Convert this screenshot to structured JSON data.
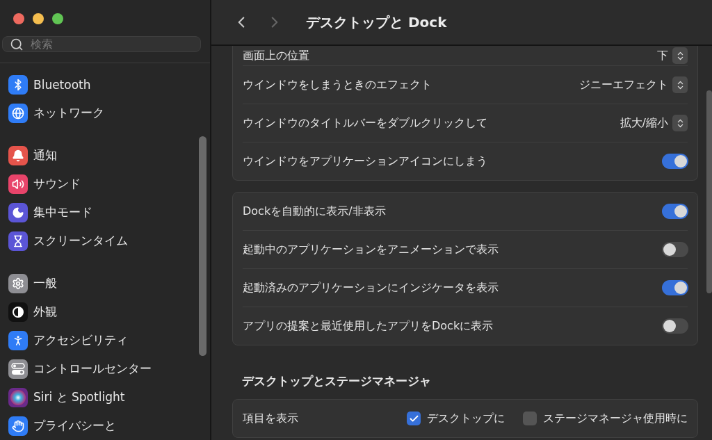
{
  "window": {
    "title": "デスクトップと Dock"
  },
  "search": {
    "placeholder": "検索"
  },
  "sidebar": {
    "groups": [
      [
        {
          "label": "Bluetooth",
          "color": "#2f7cf6"
        },
        {
          "label": "ネットワーク",
          "color": "#2f7cf6"
        }
      ],
      [
        {
          "label": "通知",
          "color": "#e5544b"
        },
        {
          "label": "サウンド",
          "color": "#e8446a"
        },
        {
          "label": "集中モード",
          "color": "#5b55d6"
        },
        {
          "label": "スクリーンタイム",
          "color": "#5b55d6"
        }
      ],
      [
        {
          "label": "一般",
          "color": "#8e8e93"
        },
        {
          "label": "外観",
          "color": "#111111"
        },
        {
          "label": "アクセシビリティ",
          "color": "#2f7cf6"
        },
        {
          "label": "コントロールセンター",
          "color": "#8e8e93"
        },
        {
          "label": "Siri と Spotlight",
          "color": "#6a2a8a"
        },
        {
          "label": "プライバシーと",
          "color": "#2f7cf6"
        }
      ]
    ]
  },
  "cards": [
    {
      "rows": [
        {
          "kind": "popup",
          "label": "画面上の位置",
          "value": "下"
        },
        {
          "kind": "popup",
          "label": "ウインドウをしまうときのエフェクト",
          "value": "ジニーエフェクト"
        },
        {
          "kind": "popup",
          "label": "ウインドウのタイトルバーをダブルクリックして",
          "value": "拡大/縮小"
        },
        {
          "kind": "toggle",
          "label": "ウインドウをアプリケーションアイコンにしまう",
          "on": true
        }
      ]
    },
    {
      "rows": [
        {
          "kind": "toggle",
          "label": "Dockを自動的に表示/非表示",
          "on": true
        },
        {
          "kind": "toggle",
          "label": "起動中のアプリケーションをアニメーションで表示",
          "on": false
        },
        {
          "kind": "toggle",
          "label": "起動済みのアプリケーションにインジケータを表示",
          "on": true
        },
        {
          "kind": "toggle",
          "label": "アプリの提案と最近使用したアプリをDockに表示",
          "on": false
        }
      ]
    },
    {
      "heading": "デスクトップとステージマネージャ",
      "rows": [
        {
          "kind": "checks",
          "label": "項目を表示",
          "options": [
            {
              "label": "デスクトップに",
              "checked": true
            },
            {
              "label": "ステージマネージャ使用時に",
              "checked": false
            }
          ]
        }
      ]
    }
  ]
}
